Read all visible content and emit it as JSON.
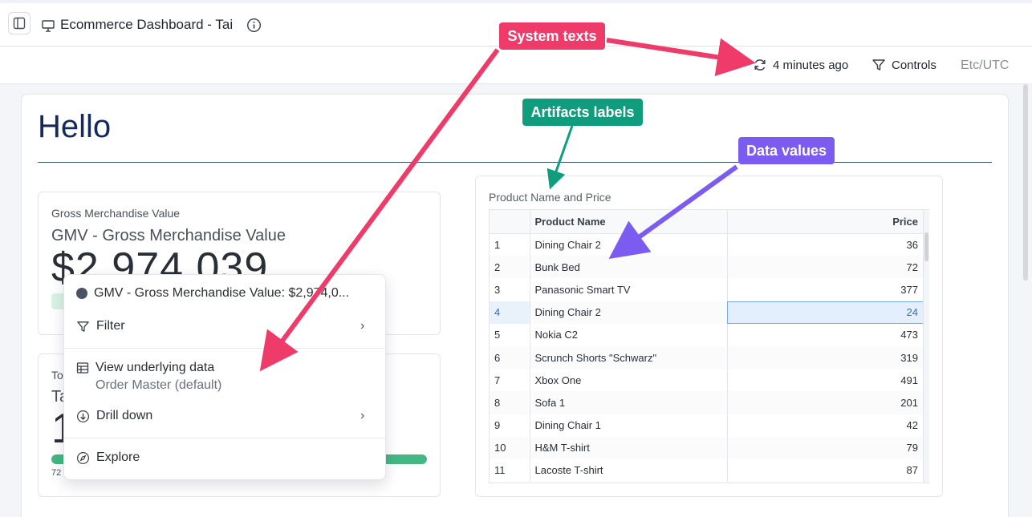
{
  "header": {
    "title": "Ecommerce Dashboard - Tai"
  },
  "toolbar": {
    "refresh_label": "4 minutes ago",
    "controls_label": "Controls",
    "timezone": "Etc/UTC"
  },
  "main": {
    "heading": "Hello"
  },
  "card_gmv": {
    "label": "Gross Merchandise Value",
    "title": "GMV - Gross Merchandise Value",
    "value": "$2,974,039"
  },
  "card_second": {
    "label": "To",
    "title": "Ta",
    "value": "1",
    "small": "72",
    "progress_percent": 100
  },
  "table_card": {
    "title": "Product Name and Price",
    "columns": [
      "",
      "Product Name",
      "Price"
    ],
    "rows": [
      {
        "idx": "1",
        "name": "Dining Chair 2",
        "price": "36"
      },
      {
        "idx": "2",
        "name": "Bunk Bed",
        "price": "72"
      },
      {
        "idx": "3",
        "name": "Panasonic Smart TV",
        "price": "377"
      },
      {
        "idx": "4",
        "name": "Dining Chair 2",
        "price": "24"
      },
      {
        "idx": "5",
        "name": "Nokia C2",
        "price": "473"
      },
      {
        "idx": "6",
        "name": "Scrunch Shorts \"Schwarz\"",
        "price": "319"
      },
      {
        "idx": "7",
        "name": "Xbox One",
        "price": "491"
      },
      {
        "idx": "8",
        "name": "Sofa 1",
        "price": "201"
      },
      {
        "idx": "9",
        "name": "Dining Chair 1",
        "price": "42"
      },
      {
        "idx": "10",
        "name": "H&M T-shirt",
        "price": "79"
      },
      {
        "idx": "11",
        "name": "Lacoste T-shirt",
        "price": "87"
      }
    ],
    "selected_row": 3
  },
  "context_menu": {
    "item1": "GMV - Gross Merchandise Value: $2,974,0...",
    "filter": "Filter",
    "view_data": "View underlying data",
    "view_data_sub": "Order Master (default)",
    "drill_down": "Drill down",
    "explore": "Explore"
  },
  "annotations": {
    "system_texts": "System texts",
    "artifacts_labels": "Artifacts labels",
    "data_values": "Data values"
  },
  "colors": {
    "accent_red": "#ef3b6a",
    "accent_green": "#0f9d7e",
    "accent_purple": "#7c5cf0",
    "heading": "#15295a"
  },
  "icons": {
    "sidebar": "sidebar-toggle-icon",
    "dashboard": "presentation-icon",
    "info": "info-icon",
    "refresh": "refresh-icon",
    "controls": "filter-icon",
    "view_data": "table-icon",
    "drill": "drill-down-icon",
    "explore": "compass-icon"
  }
}
